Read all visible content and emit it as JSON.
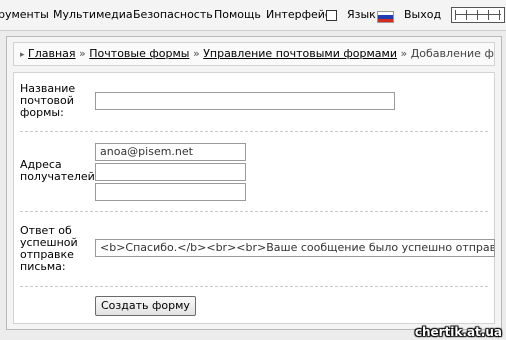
{
  "menu": {
    "items": [
      "рументы",
      "Мультимедиа",
      "Безопасность",
      "Помощь",
      "Интерфейс",
      "Язык",
      "Выход"
    ]
  },
  "breadcrumb": {
    "links": [
      "Главная",
      "Почтовые формы",
      "Управление почтовыми формами"
    ],
    "separator": "»",
    "current": "Добавление формы"
  },
  "form": {
    "name_label_1": "Название",
    "name_label_2": "почтовой",
    "name_label_3": "формы:",
    "name_value": "",
    "recipients_label_1": "Адреса",
    "recipients_label_2": "получателей:",
    "recipients": [
      "anoa@pisem.net",
      "",
      ""
    ],
    "reply_label_1": "Ответ об",
    "reply_label_2": "успешной",
    "reply_label_3": "отправке",
    "reply_label_4": "письма:",
    "reply_value": "<b>Спасибо.</b><br><br>Ваше сообщение было успешно отправлено.",
    "submit_label": "Создать форму"
  },
  "watermark": "chertik.at.ua",
  "colors": {
    "flag_white": "#ffffff",
    "flag_blue": "#1f3fb0",
    "flag_red": "#d52b1e"
  }
}
